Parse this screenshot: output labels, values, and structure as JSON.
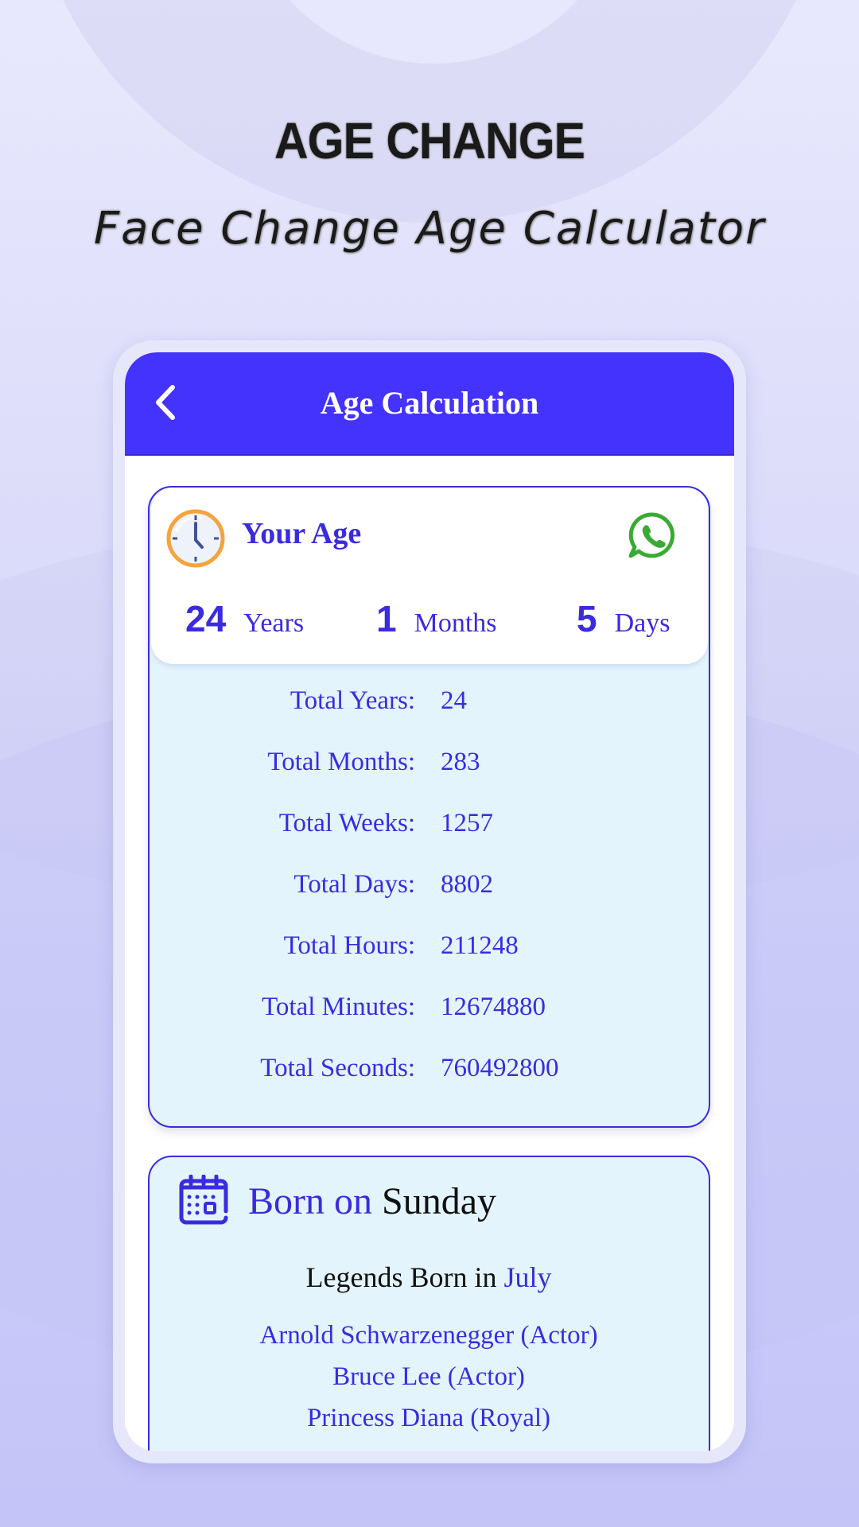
{
  "promo": {
    "title": "AGE CHANGE",
    "subtitle": "Face Change Age Calculator"
  },
  "app_bar": {
    "title": "Age Calculation",
    "back_icon": "chevron-left-icon"
  },
  "age_card": {
    "heading": "Your Age",
    "clock_icon": "clock-icon",
    "share_icon": "whatsapp-icon",
    "years": {
      "value": "24",
      "unit": "Years"
    },
    "months": {
      "value": "1",
      "unit": "Months"
    },
    "days": {
      "value": "5",
      "unit": "Days"
    },
    "totals": [
      {
        "label": "Total Years:",
        "value": "24"
      },
      {
        "label": "Total Months:",
        "value": "283"
      },
      {
        "label": "Total Weeks:",
        "value": "1257"
      },
      {
        "label": "Total Days:",
        "value": "8802"
      },
      {
        "label": "Total Hours:",
        "value": "211248"
      },
      {
        "label": "Total Minutes:",
        "value": "12674880"
      },
      {
        "label": "Total Seconds:",
        "value": "760492800"
      }
    ]
  },
  "born_card": {
    "calendar_icon": "calendar-icon",
    "born_prefix": "Born on ",
    "born_day": "Sunday",
    "legends_prefix": "Legends Born in ",
    "legends_month": "July",
    "legends": [
      "Arnold Schwarzenegger (Actor)",
      "Bruce Lee (Actor)",
      "Princess Diana (Royal)"
    ]
  },
  "colors": {
    "accent": "#4432fd",
    "text_accent": "#3a2be0",
    "card_bg": "#e3f4fd",
    "clock_ring": "#f3a43e",
    "whatsapp": "#3aaa35"
  }
}
